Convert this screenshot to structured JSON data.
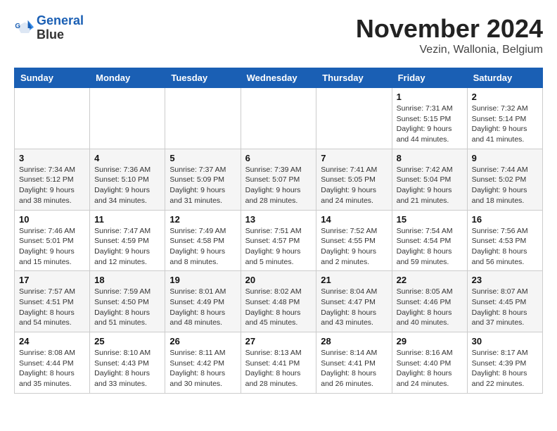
{
  "logo": {
    "line1": "General",
    "line2": "Blue"
  },
  "title": "November 2024",
  "location": "Vezin, Wallonia, Belgium",
  "days_of_week": [
    "Sunday",
    "Monday",
    "Tuesday",
    "Wednesday",
    "Thursday",
    "Friday",
    "Saturday"
  ],
  "weeks": [
    [
      {
        "day": "",
        "info": ""
      },
      {
        "day": "",
        "info": ""
      },
      {
        "day": "",
        "info": ""
      },
      {
        "day": "",
        "info": ""
      },
      {
        "day": "",
        "info": ""
      },
      {
        "day": "1",
        "info": "Sunrise: 7:31 AM\nSunset: 5:15 PM\nDaylight: 9 hours and 44 minutes."
      },
      {
        "day": "2",
        "info": "Sunrise: 7:32 AM\nSunset: 5:14 PM\nDaylight: 9 hours and 41 minutes."
      }
    ],
    [
      {
        "day": "3",
        "info": "Sunrise: 7:34 AM\nSunset: 5:12 PM\nDaylight: 9 hours and 38 minutes."
      },
      {
        "day": "4",
        "info": "Sunrise: 7:36 AM\nSunset: 5:10 PM\nDaylight: 9 hours and 34 minutes."
      },
      {
        "day": "5",
        "info": "Sunrise: 7:37 AM\nSunset: 5:09 PM\nDaylight: 9 hours and 31 minutes."
      },
      {
        "day": "6",
        "info": "Sunrise: 7:39 AM\nSunset: 5:07 PM\nDaylight: 9 hours and 28 minutes."
      },
      {
        "day": "7",
        "info": "Sunrise: 7:41 AM\nSunset: 5:05 PM\nDaylight: 9 hours and 24 minutes."
      },
      {
        "day": "8",
        "info": "Sunrise: 7:42 AM\nSunset: 5:04 PM\nDaylight: 9 hours and 21 minutes."
      },
      {
        "day": "9",
        "info": "Sunrise: 7:44 AM\nSunset: 5:02 PM\nDaylight: 9 hours and 18 minutes."
      }
    ],
    [
      {
        "day": "10",
        "info": "Sunrise: 7:46 AM\nSunset: 5:01 PM\nDaylight: 9 hours and 15 minutes."
      },
      {
        "day": "11",
        "info": "Sunrise: 7:47 AM\nSunset: 4:59 PM\nDaylight: 9 hours and 12 minutes."
      },
      {
        "day": "12",
        "info": "Sunrise: 7:49 AM\nSunset: 4:58 PM\nDaylight: 9 hours and 8 minutes."
      },
      {
        "day": "13",
        "info": "Sunrise: 7:51 AM\nSunset: 4:57 PM\nDaylight: 9 hours and 5 minutes."
      },
      {
        "day": "14",
        "info": "Sunrise: 7:52 AM\nSunset: 4:55 PM\nDaylight: 9 hours and 2 minutes."
      },
      {
        "day": "15",
        "info": "Sunrise: 7:54 AM\nSunset: 4:54 PM\nDaylight: 8 hours and 59 minutes."
      },
      {
        "day": "16",
        "info": "Sunrise: 7:56 AM\nSunset: 4:53 PM\nDaylight: 8 hours and 56 minutes."
      }
    ],
    [
      {
        "day": "17",
        "info": "Sunrise: 7:57 AM\nSunset: 4:51 PM\nDaylight: 8 hours and 54 minutes."
      },
      {
        "day": "18",
        "info": "Sunrise: 7:59 AM\nSunset: 4:50 PM\nDaylight: 8 hours and 51 minutes."
      },
      {
        "day": "19",
        "info": "Sunrise: 8:01 AM\nSunset: 4:49 PM\nDaylight: 8 hours and 48 minutes."
      },
      {
        "day": "20",
        "info": "Sunrise: 8:02 AM\nSunset: 4:48 PM\nDaylight: 8 hours and 45 minutes."
      },
      {
        "day": "21",
        "info": "Sunrise: 8:04 AM\nSunset: 4:47 PM\nDaylight: 8 hours and 43 minutes."
      },
      {
        "day": "22",
        "info": "Sunrise: 8:05 AM\nSunset: 4:46 PM\nDaylight: 8 hours and 40 minutes."
      },
      {
        "day": "23",
        "info": "Sunrise: 8:07 AM\nSunset: 4:45 PM\nDaylight: 8 hours and 37 minutes."
      }
    ],
    [
      {
        "day": "24",
        "info": "Sunrise: 8:08 AM\nSunset: 4:44 PM\nDaylight: 8 hours and 35 minutes."
      },
      {
        "day": "25",
        "info": "Sunrise: 8:10 AM\nSunset: 4:43 PM\nDaylight: 8 hours and 33 minutes."
      },
      {
        "day": "26",
        "info": "Sunrise: 8:11 AM\nSunset: 4:42 PM\nDaylight: 8 hours and 30 minutes."
      },
      {
        "day": "27",
        "info": "Sunrise: 8:13 AM\nSunset: 4:41 PM\nDaylight: 8 hours and 28 minutes."
      },
      {
        "day": "28",
        "info": "Sunrise: 8:14 AM\nSunset: 4:41 PM\nDaylight: 8 hours and 26 minutes."
      },
      {
        "day": "29",
        "info": "Sunrise: 8:16 AM\nSunset: 4:40 PM\nDaylight: 8 hours and 24 minutes."
      },
      {
        "day": "30",
        "info": "Sunrise: 8:17 AM\nSunset: 4:39 PM\nDaylight: 8 hours and 22 minutes."
      }
    ]
  ]
}
